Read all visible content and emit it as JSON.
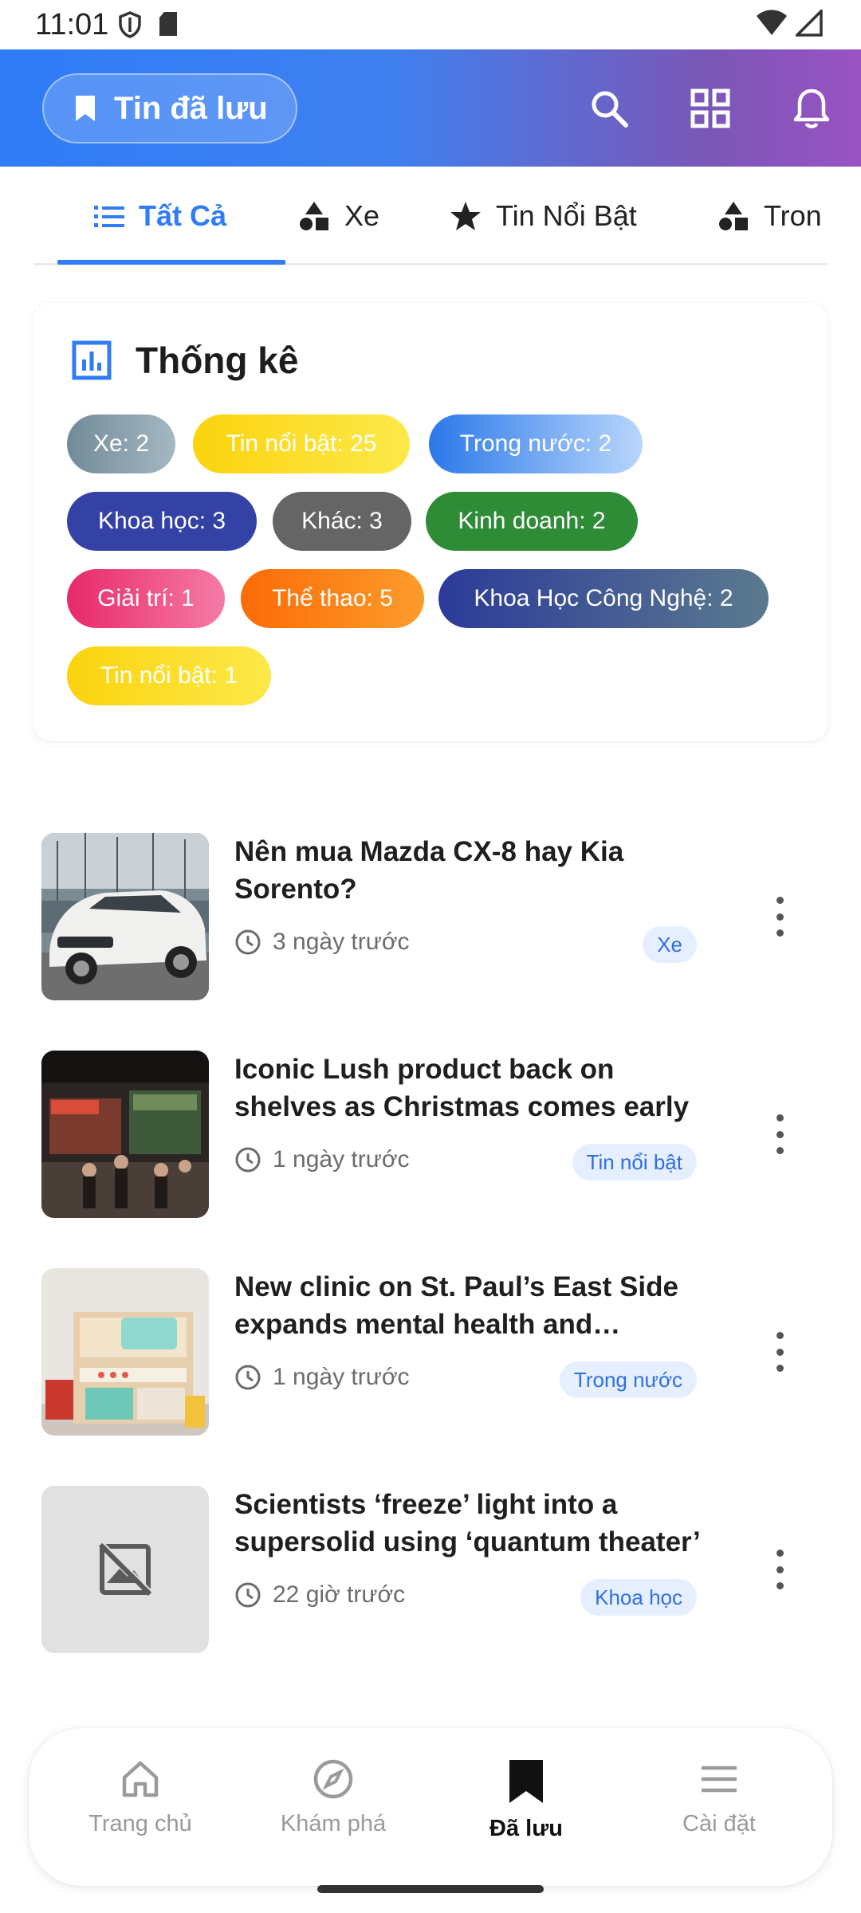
{
  "status_bar": {
    "time": "11:01"
  },
  "app_bar": {
    "title": "Tin đã lưu",
    "icons": [
      "bookmark-icon",
      "search-icon",
      "grid-icon",
      "bell-icon"
    ],
    "gradient": [
      "#2f7cf6",
      "#9a52c2"
    ]
  },
  "tabs": [
    {
      "label": "Tất Cả",
      "icon": "list-icon",
      "active": true
    },
    {
      "label": "Xe",
      "icon": "category-icon"
    },
    {
      "label": "Tin Nổi Bật",
      "icon": "star-icon"
    },
    {
      "label": "Tron",
      "icon": "category-icon"
    }
  ],
  "stats": {
    "title": "Thống kê",
    "chips": [
      {
        "label": "Xe: 2",
        "color": "#7b95a3"
      },
      {
        "label": "Tin nổi bật: 25",
        "color": "#fbd818"
      },
      {
        "label": "Trong nước: 2",
        "color": "#3f8cf0"
      },
      {
        "label": "Khoa học: 3",
        "color": "#3949ab"
      },
      {
        "label": "Khác: 3",
        "color": "#6a6a6a"
      },
      {
        "label": "Kinh doanh: 2",
        "color": "#2f8c3a"
      },
      {
        "label": "Giải trí: 1",
        "color": "#ec3d75"
      },
      {
        "label": "Thể thao: 5",
        "color": "#fb7c0a"
      },
      {
        "label": "Khoa Học Công Nghệ: 2",
        "color": "#3d4fa6"
      },
      {
        "label": "Tin nổi bật: 1",
        "color": "#fbd818"
      }
    ]
  },
  "news": [
    {
      "title": "Nên mua Mazda CX-8 hay Kia Sorento?",
      "time": "3 ngày trước",
      "tag": "Xe",
      "thumb": "car-photo"
    },
    {
      "title": "Iconic Lush product back on shelves as Christmas comes early",
      "time": "1 ngày trước",
      "tag": "Tin nổi bật",
      "thumb": "store-photo"
    },
    {
      "title": "New clinic on St. Paul’s East Side expands mental health and substance use services",
      "time": "1 ngày trước",
      "tag": "Trong nước",
      "thumb": "toy-kitchen-photo"
    },
    {
      "title": "Scientists ‘freeze’ light into a supersolid using ‘quantum theater’",
      "time": "22 giờ trước",
      "tag": "Khoa học",
      "thumb": "image-placeholder-icon"
    }
  ],
  "bottom_nav": [
    {
      "label": "Trang chủ",
      "icon": "home-icon"
    },
    {
      "label": "Khám phá",
      "icon": "compass-icon"
    },
    {
      "label": "Đã lưu",
      "icon": "bookmark-icon",
      "active": true
    },
    {
      "label": "Cài đặt",
      "icon": "menu-icon"
    }
  ]
}
